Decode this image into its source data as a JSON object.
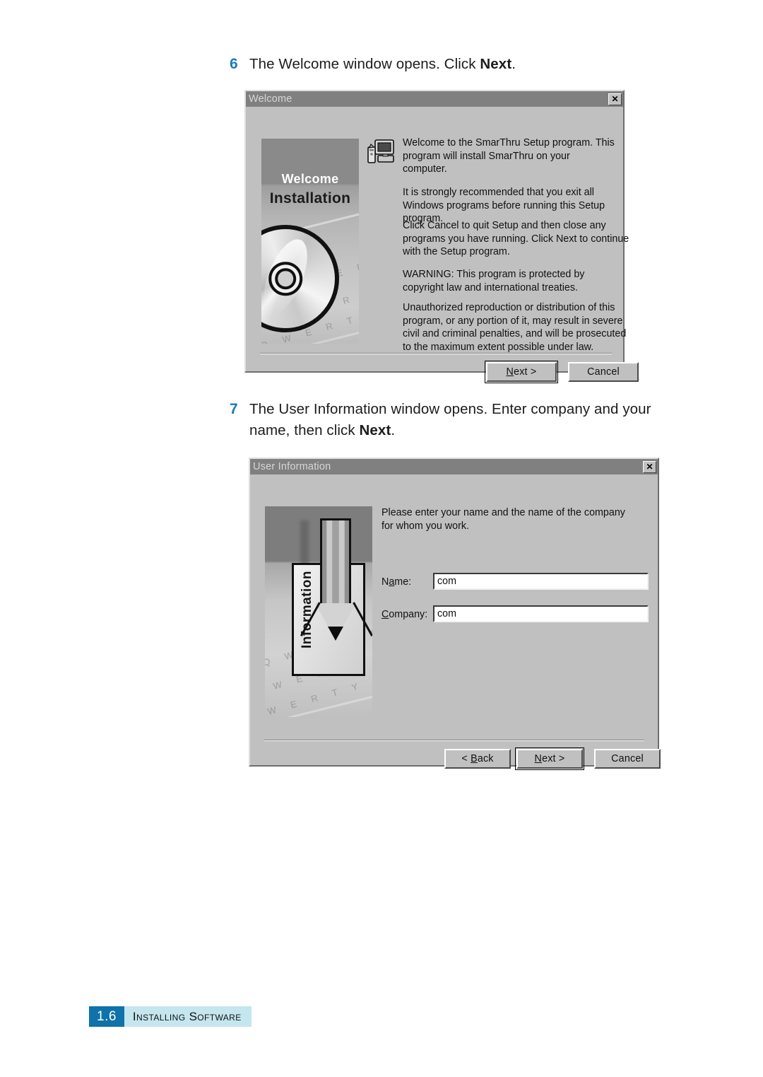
{
  "page": {
    "footer": {
      "number": "1.6",
      "section": "Installing Software"
    }
  },
  "steps": [
    {
      "number": "6",
      "text_before": "The Welcome window opens. Click ",
      "text_bold": "Next",
      "text_after": "."
    },
    {
      "number": "7",
      "text_before": "The User Information window opens. Enter company and your name, then click ",
      "text_bold": "Next",
      "text_after": "."
    }
  ],
  "dialogs": {
    "welcome": {
      "title": "Welcome",
      "close_glyph": "✕",
      "banner": {
        "line1": "Welcome",
        "line2": "Installation",
        "keycaps": "Q W E R T Y"
      },
      "icon_name": "setup-computer-icon",
      "paragraphs": [
        "Welcome to the SmarThru Setup program.  This program will install SmarThru on your computer.",
        "It is strongly recommended that you exit all Windows programs before running this Setup program.",
        "Click Cancel to quit Setup and then close any programs you have running.  Click Next to continue with the Setup program.",
        "WARNING: This program is protected by copyright law and international treaties.",
        "Unauthorized reproduction or distribution of this program, or any portion of it, may result in severe civil and criminal penalties, and will be prosecuted to the maximum extent possible under law."
      ],
      "buttons": {
        "next_prefix": "",
        "next_accel": "N",
        "next_suffix": "ext >",
        "cancel": "Cancel"
      }
    },
    "user_information": {
      "title": "User Information",
      "close_glyph": "✕",
      "banner": {
        "label": "Information"
      },
      "instruction": "Please enter your name and the name of the company for whom you work.",
      "fields": [
        {
          "label_prefix": "N",
          "label_accel": "a",
          "label_suffix": "me:",
          "value": "com",
          "placeholder": ""
        },
        {
          "label_prefix": "",
          "label_accel": "C",
          "label_suffix": "ompany:",
          "value": "com",
          "placeholder": ""
        }
      ],
      "buttons": {
        "back_prefix": "< ",
        "back_accel": "B",
        "back_suffix": "ack",
        "next_prefix": "",
        "next_accel": "N",
        "next_suffix": "ext >",
        "cancel": "Cancel"
      }
    }
  },
  "colors": {
    "accent_blue": "#1b7bb5",
    "footer_dark": "#0f72a8",
    "footer_light": "#c5e6ef",
    "dialog_face": "#c0c0c0",
    "titlebar": "#808080"
  }
}
